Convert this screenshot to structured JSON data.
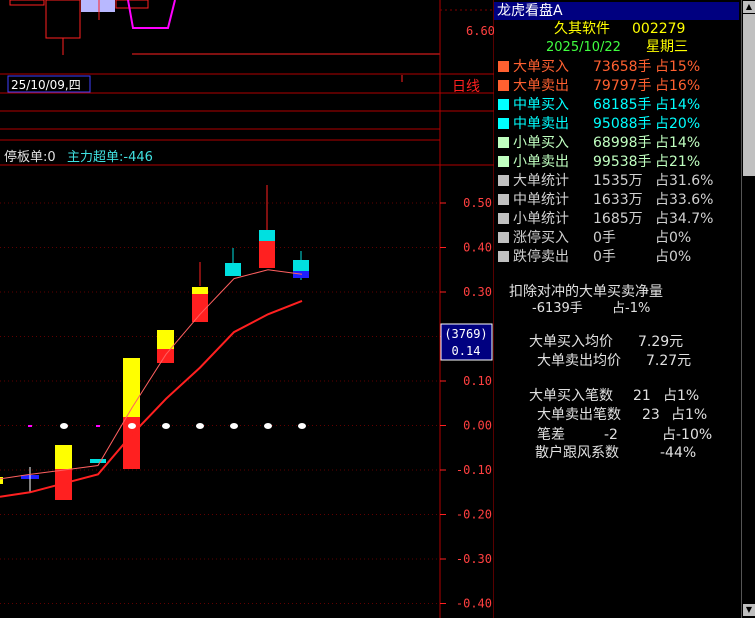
{
  "chart": {
    "date_label": "25/10/09,四",
    "period_label": "日线",
    "indicator_label_1": "停板单:0",
    "indicator_label_2": "主力超单:-446",
    "price_top": "6.60",
    "y_ticks": [
      "0.50",
      "0.40",
      "0.30",
      "0.20",
      "0.10",
      "0.00",
      "-0.10",
      "-0.20",
      "-0.30",
      "-0.40"
    ],
    "cursor_box_top": "(3769)",
    "cursor_box_bottom": "0.14",
    "colors": {
      "up": "#ff2020",
      "down": "#00e0e0",
      "yellow": "#ffff00",
      "white_line": "#ff8080",
      "ma_line": "#ff2020",
      "grid": "#800000",
      "axis_text": "#ff4040"
    }
  },
  "chart_data": {
    "type": "bar",
    "ylim": [
      -0.42,
      0.56
    ],
    "ma_line_points": [
      -0.16,
      -0.15,
      -0.13,
      -0.11,
      -0.02,
      0.06,
      0.13,
      0.21,
      0.25,
      0.28
    ],
    "thin_line_points": [
      -0.12,
      -0.11,
      -0.1,
      -0.09,
      0.04,
      0.16,
      0.25,
      0.33,
      0.35,
      0.34
    ]
  },
  "panel": {
    "title": "龙虎看盘A",
    "stock_name": "久其软件",
    "stock_code": "002279",
    "date": "2025/10/22",
    "weekday": "星期三",
    "rows": [
      {
        "label": "大单买入",
        "value": "73658手",
        "pct": "占15%",
        "color": "#ff6030",
        "text_color": "#ff6030"
      },
      {
        "label": "大单卖出",
        "value": "79797手",
        "pct": "占16%",
        "color": "#ff6030",
        "text_color": "#ff6030"
      },
      {
        "label": "中单买入",
        "value": "68185手",
        "pct": "占14%",
        "color": "#00ffff",
        "text_color": "#00ffff"
      },
      {
        "label": "中单卖出",
        "value": "95088手",
        "pct": "占20%",
        "color": "#00ffff",
        "text_color": "#00ffff"
      },
      {
        "label": "小单买入",
        "value": "68998手",
        "pct": "占14%",
        "color": "#c0ffc0",
        "text_color": "#c0ffc0"
      },
      {
        "label": "小单卖出",
        "value": "99538手",
        "pct": "占21%",
        "color": "#c0ffc0",
        "text_color": "#c0ffc0"
      },
      {
        "label": "大单统计",
        "value": "1535万",
        "pct": "占31.6%",
        "color": "#c0c0c0",
        "text_color": "#d0d0d0"
      },
      {
        "label": "中单统计",
        "value": "1633万",
        "pct": "占33.6%",
        "color": "#c0c0c0",
        "text_color": "#d0d0d0"
      },
      {
        "label": "小单统计",
        "value": "1685万",
        "pct": "占34.7%",
        "color": "#c0c0c0",
        "text_color": "#d0d0d0"
      },
      {
        "label": "涨停买入",
        "value": "0手",
        "pct": "占0%",
        "color": "#c0c0c0",
        "text_color": "#d0d0d0"
      },
      {
        "label": "跌停卖出",
        "value": "0手",
        "pct": "占0%",
        "color": "#c0c0c0",
        "text_color": "#d0d0d0"
      }
    ],
    "net_title": "扣除对冲的大单买卖净量",
    "net_value": "-6139手",
    "net_pct": "占-1%",
    "buy_avg_label": "大单买入均价",
    "buy_avg_value": "7.29元",
    "sell_avg_label": "大单卖出均价",
    "sell_avg_value": "7.27元",
    "buy_count_label": "大单买入笔数",
    "buy_count_value": "21",
    "buy_count_pct": "占1%",
    "sell_count_label": "大单卖出笔数",
    "sell_count_value": "23",
    "sell_count_pct": "占1%",
    "diff_label": "笔差",
    "diff_value": "-2",
    "diff_pct": "占-10%",
    "retail_label": "散户跟风系数",
    "retail_value": "-44%"
  }
}
